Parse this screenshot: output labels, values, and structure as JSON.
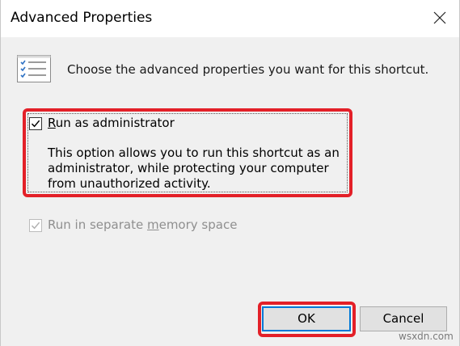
{
  "window": {
    "title": "Advanced Properties",
    "close_icon": "close-icon"
  },
  "header": {
    "icon": "properties-list-icon",
    "description": "Choose the advanced properties you want for this shortcut."
  },
  "options": {
    "run_as_admin": {
      "label_accel": "R",
      "label_rest": "un as administrator",
      "checked": true,
      "enabled": true,
      "description": "This option allows you to run this shortcut as an administrator, while protecting your computer from unauthorized activity."
    },
    "separate_memory": {
      "label_pre": "Run in separate ",
      "label_accel": "m",
      "label_post": "emory space",
      "checked": true,
      "enabled": false
    }
  },
  "buttons": {
    "ok": "OK",
    "cancel": "Cancel"
  },
  "watermark": "wsxdn.com",
  "colors": {
    "highlight": "#e32028",
    "focus_border": "#0078d7",
    "dialog_bg": "#f0f0f0",
    "disabled_text": "#8f8f8f"
  }
}
